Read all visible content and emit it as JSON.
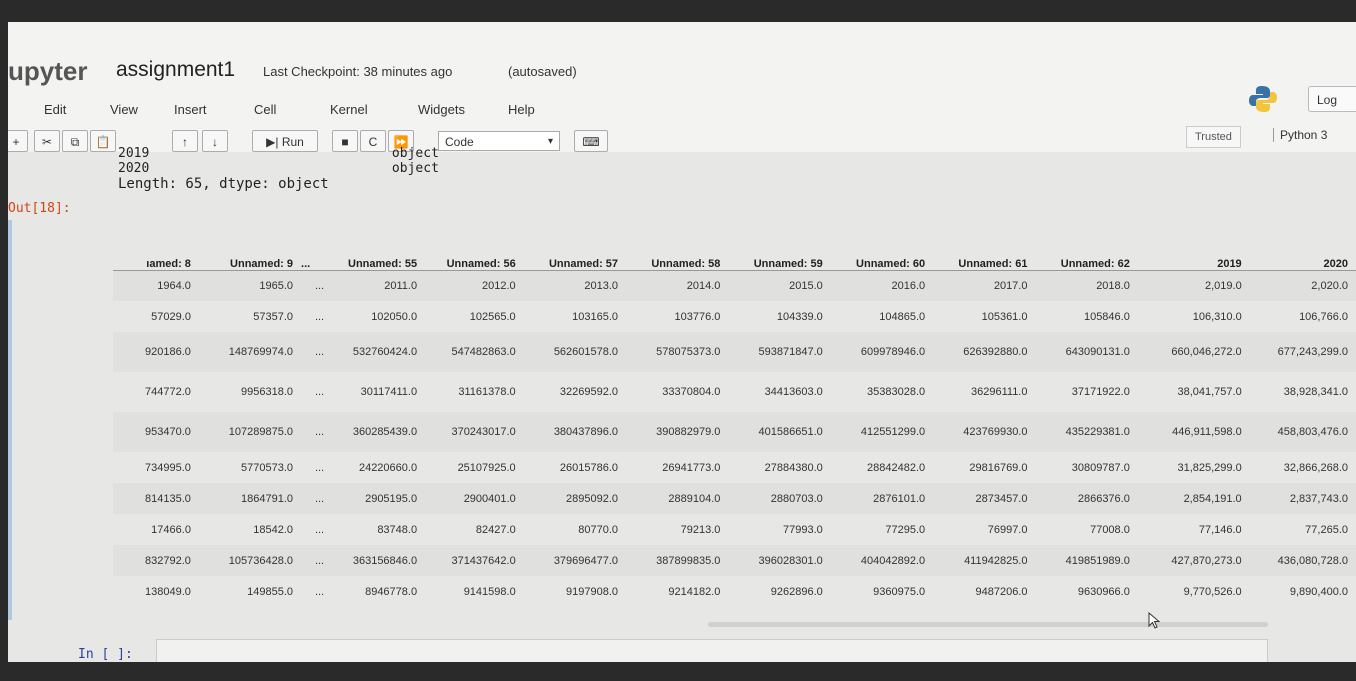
{
  "header": {
    "logo_text": "upyter",
    "notebook_name": "assignment1",
    "checkpoint": "Last Checkpoint: 38 minutes ago",
    "autosave": "(autosaved)",
    "logout_label": "Log"
  },
  "menu": {
    "items": [
      "Edit",
      "View",
      "Insert",
      "Cell",
      "Kernel",
      "Widgets",
      "Help"
    ]
  },
  "toolbar": {
    "run_label": "Run",
    "cell_type": "Code",
    "trusted_label": "Trusted",
    "kernel_label": "Python 3"
  },
  "prev_output": {
    "lines": [
      "2019                               object",
      "2020                               object",
      "Length: 65, dtype: object"
    ]
  },
  "output": {
    "prompt": "Out[18]:",
    "columns": [
      "ıamed: 8",
      "Unnamed: 9",
      "...",
      "Unnamed: 55",
      "Unnamed: 56",
      "Unnamed: 57",
      "Unnamed: 58",
      "Unnamed: 59",
      "Unnamed: 60",
      "Unnamed: 61",
      "Unnamed: 62",
      "2019",
      "2020"
    ],
    "rows": [
      [
        "1964.0",
        "1965.0",
        "...",
        "2011.0",
        "2012.0",
        "2013.0",
        "2014.0",
        "2015.0",
        "2016.0",
        "2017.0",
        "2018.0",
        "2,019.0",
        "2,020.0"
      ],
      [
        "57029.0",
        "57357.0",
        "...",
        "102050.0",
        "102565.0",
        "103165.0",
        "103776.0",
        "104339.0",
        "104865.0",
        "105361.0",
        "105846.0",
        "106,310.0",
        "106,766.0"
      ],
      [
        "920186.0",
        "148769974.0",
        "...",
        "532760424.0",
        "547482863.0",
        "562601578.0",
        "578075373.0",
        "593871847.0",
        "609978946.0",
        "626392880.0",
        "643090131.0",
        "660,046,272.0",
        "677,243,299.0"
      ],
      [
        "744772.0",
        "9956318.0",
        "...",
        "30117411.0",
        "31161378.0",
        "32269592.0",
        "33370804.0",
        "34413603.0",
        "35383028.0",
        "36296111.0",
        "37171922.0",
        "38,041,757.0",
        "38,928,341.0"
      ],
      [
        "953470.0",
        "107289875.0",
        "...",
        "360285439.0",
        "370243017.0",
        "380437896.0",
        "390882979.0",
        "401586651.0",
        "412551299.0",
        "423769930.0",
        "435229381.0",
        "446,911,598.0",
        "458,803,476.0"
      ],
      [
        "734995.0",
        "5770573.0",
        "...",
        "24220660.0",
        "25107925.0",
        "26015786.0",
        "26941773.0",
        "27884380.0",
        "28842482.0",
        "29816769.0",
        "30809787.0",
        "31,825,299.0",
        "32,866,268.0"
      ],
      [
        "814135.0",
        "1864791.0",
        "...",
        "2905195.0",
        "2900401.0",
        "2895092.0",
        "2889104.0",
        "2880703.0",
        "2876101.0",
        "2873457.0",
        "2866376.0",
        "2,854,191.0",
        "2,837,743.0"
      ],
      [
        "17466.0",
        "18542.0",
        "...",
        "83748.0",
        "82427.0",
        "80770.0",
        "79213.0",
        "77993.0",
        "77295.0",
        "76997.0",
        "77008.0",
        "77,146.0",
        "77,265.0"
      ],
      [
        "832792.0",
        "105736428.0",
        "...",
        "363156846.0",
        "371437642.0",
        "379696477.0",
        "387899835.0",
        "396028301.0",
        "404042892.0",
        "411942825.0",
        "419851989.0",
        "427,870,273.0",
        "436,080,728.0"
      ],
      [
        "138049.0",
        "149855.0",
        "...",
        "8946778.0",
        "9141598.0",
        "9197908.0",
        "9214182.0",
        "9262896.0",
        "9360975.0",
        "9487206.0",
        "9630966.0",
        "9,770,526.0",
        "9,890,400.0"
      ]
    ]
  },
  "input": {
    "prompt": "In [ ]:"
  },
  "colors": {
    "out_prompt": "#d84315",
    "in_prompt": "#303f9f"
  }
}
